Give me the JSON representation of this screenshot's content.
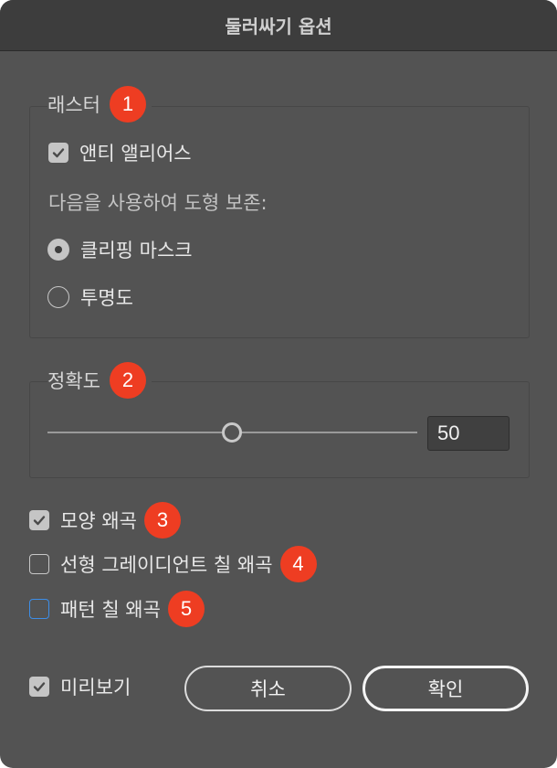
{
  "dialog": {
    "title": "둘러싸기 옵션"
  },
  "raster": {
    "legend": "래스터",
    "badge": "1",
    "antialias_label": "앤티 앨리어스",
    "antialias_checked": true,
    "preserve_label": "다음을 사용하여 도형 보존:",
    "options": [
      {
        "label": "클리핑 마스크",
        "selected": true
      },
      {
        "label": "투명도",
        "selected": false
      }
    ]
  },
  "fidelity": {
    "legend": "정확도",
    "badge": "2",
    "value": "50",
    "slider_value": 50,
    "slider_min": 0,
    "slider_max": 100
  },
  "distort": {
    "appearance": {
      "label": "모양 왜곡",
      "badge": "3",
      "checked": true
    },
    "linear_gradient": {
      "label": "선형 그레이디언트 칠 왜곡",
      "badge": "4",
      "checked": false
    },
    "pattern": {
      "label": "패턴 칠 왜곡",
      "badge": "5",
      "checked": false
    }
  },
  "footer": {
    "preview_label": "미리보기",
    "preview_checked": true,
    "cancel_label": "취소",
    "ok_label": "확인"
  },
  "colors": {
    "dialog_bg": "#535353",
    "titlebar_bg": "#3d3d3d",
    "badge": "#ee3d22",
    "focus": "#3d8ee8"
  }
}
